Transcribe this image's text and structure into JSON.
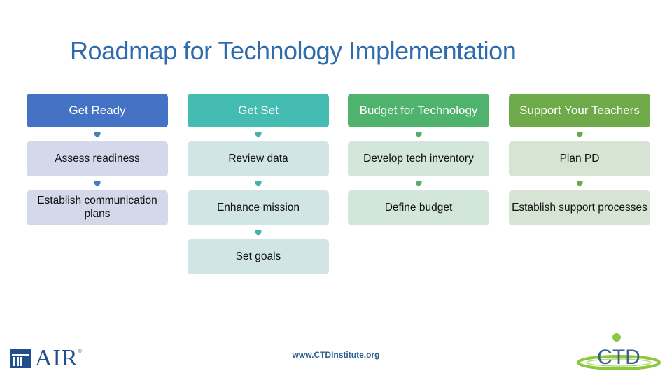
{
  "title": "Roadmap for Technology Implementation",
  "columns": [
    {
      "header": "Get Ready",
      "header_color": "#4472c4",
      "step_color": "#d3d9ea",
      "arrow_color": "#4a7ebb",
      "steps": [
        "Assess readiness",
        "Establish communication plans"
      ]
    },
    {
      "header": "Get Set",
      "header_color": "#45bcb2",
      "step_color": "#d2e5e6",
      "arrow_color": "#44b3ab",
      "steps": [
        "Review data",
        "Enhance mission",
        "Set goals"
      ]
    },
    {
      "header": "Budget for Technology",
      "header_color": "#4fb36d",
      "step_color": "#d3e6da",
      "arrow_color": "#58ac6a",
      "steps": [
        "Develop tech inventory",
        "Define budget"
      ]
    },
    {
      "header": "Support Your Teachers",
      "header_color": "#6ea94a",
      "step_color": "#d8e4d3",
      "arrow_color": "#6aa84f",
      "steps": [
        "Plan PD",
        "Establish support processes"
      ]
    }
  ],
  "footer": {
    "url": "www.CTDInstitute.org",
    "left_logo": "AIR",
    "left_logo_mark": "®",
    "right_logo": "CTD"
  }
}
